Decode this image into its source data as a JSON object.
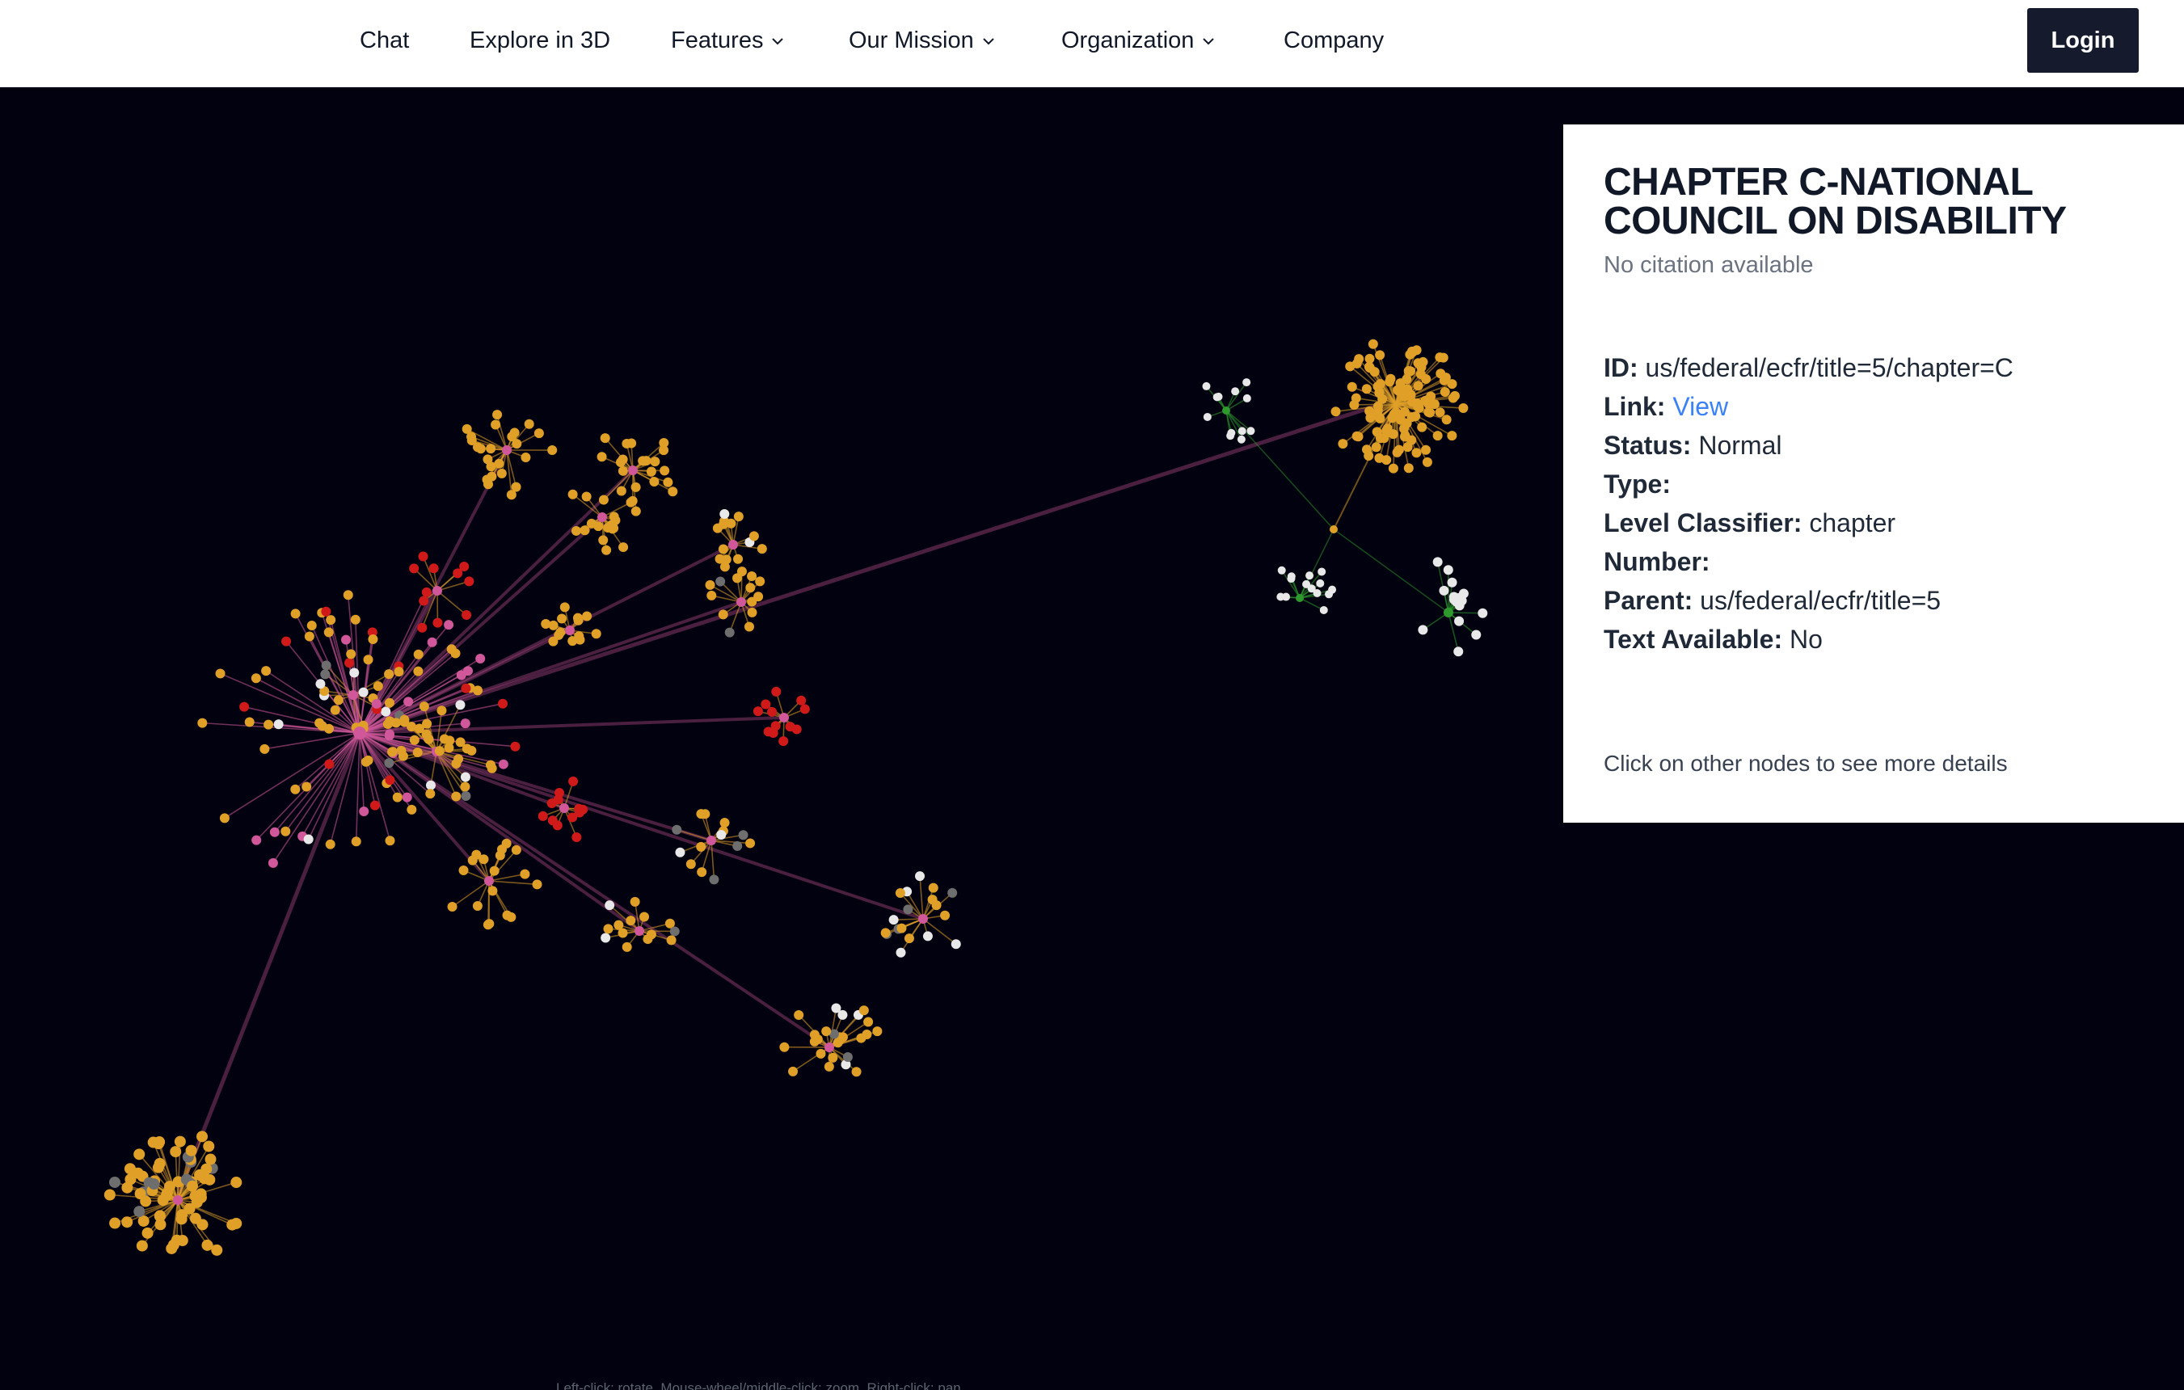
{
  "nav": {
    "items": [
      {
        "label": "Chat",
        "dropdown": false
      },
      {
        "label": "Explore in 3D",
        "dropdown": false
      },
      {
        "label": "Features",
        "dropdown": true
      },
      {
        "label": "Our Mission",
        "dropdown": true
      },
      {
        "label": "Organization",
        "dropdown": true
      },
      {
        "label": "Company",
        "dropdown": false
      }
    ],
    "login_label": "Login"
  },
  "panel": {
    "title": "CHAPTER C-NATIONAL COUNCIL ON DISABILITY",
    "citation": "No citation available",
    "props": {
      "id_key": "ID:",
      "id_val": "us/federal/ecfr/title=5/chapter=C",
      "link_key": "Link:",
      "link_val": "View",
      "status_key": "Status:",
      "status_val": "Normal",
      "type_key": "Type:",
      "type_val": "",
      "level_key": "Level Classifier:",
      "level_val": "chapter",
      "number_key": "Number:",
      "number_val": "",
      "parent_key": "Parent:",
      "parent_val": "us/federal/ecfr/title=5",
      "text_key": "Text Available:",
      "text_val": "No"
    },
    "footer": "Click on other nodes to see more details"
  },
  "graph": {
    "hint": "Left-click: rotate, Mouse-wheel/middle-click: zoom, Right-click: pan",
    "colors": {
      "background": "#02010f",
      "hub": "#d0589a",
      "leaf": "#e0a028",
      "red": "#d01a1a",
      "white": "#e8e8e8",
      "gray": "#6e6e6e",
      "green": "#2e9a2e"
    }
  }
}
